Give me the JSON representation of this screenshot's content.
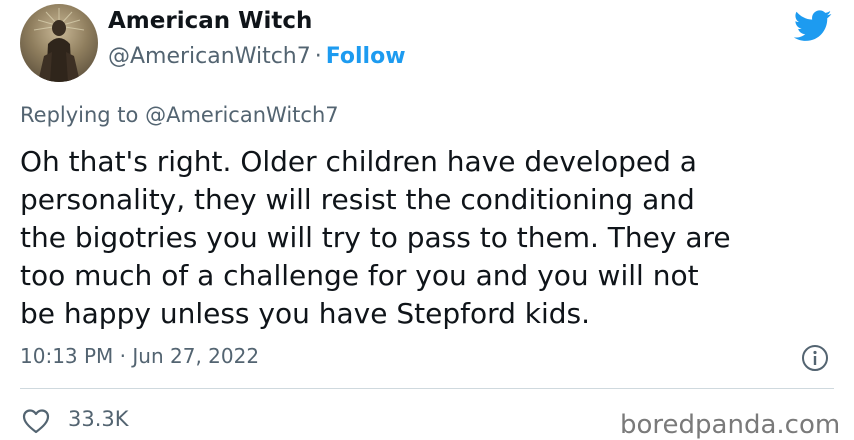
{
  "author": {
    "name": "American Witch",
    "handle": "@AmericanWitch7",
    "separator": "·",
    "follow_label": "Follow"
  },
  "reply": {
    "prefix": "Replying to",
    "mention": "@AmericanWitch7"
  },
  "tweet": {
    "lines": [
      "Oh that's right. Older children have developed a",
      "personality, they will resist the conditioning and",
      "the bigotries you will try to pass to them. They are",
      "too much of a challenge for you and you will not",
      "be happy unless you have Stepford kids."
    ],
    "timestamp": "10:13 PM · Jun 27, 2022"
  },
  "engagement": {
    "likes": "33.3K"
  },
  "watermark": "boredpanda.com",
  "colors": {
    "accent": "#1d9bf0",
    "text": "#0f1419",
    "secondary": "#536471"
  },
  "icons": {
    "brand": "twitter-bird-icon",
    "info": "info-icon",
    "like": "heart-icon"
  }
}
